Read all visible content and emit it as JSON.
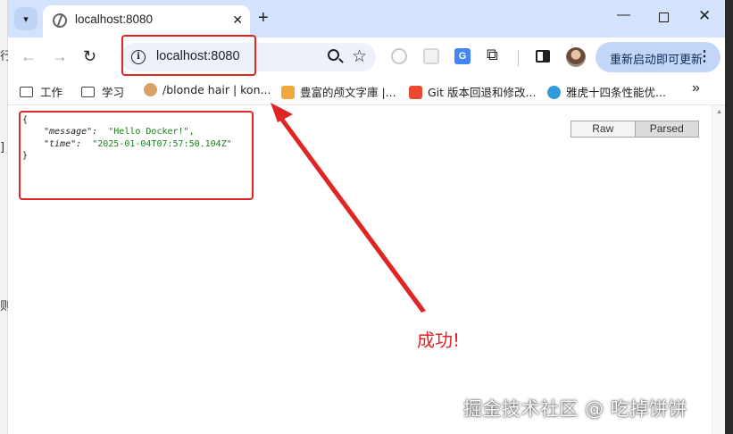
{
  "left_strip": {
    "chars": [
      "行",
      "]",
      "则"
    ]
  },
  "tab": {
    "title": "localhost:8080",
    "close": "✕"
  },
  "window_controls": {
    "new_tab": "+",
    "minimize": "—",
    "close": "✕"
  },
  "toolbar": {
    "back": "←",
    "forward": "→",
    "reload": "↻",
    "url": "localhost:8080",
    "info": "i",
    "star": "☆",
    "translate": "G",
    "extensions": "⧉",
    "update_label": "重新启动即可更新",
    "menu": "⋮"
  },
  "bookmarks": [
    {
      "label": "工作",
      "icon": "folder-icon"
    },
    {
      "label": "学习",
      "icon": "folder-icon"
    },
    {
      "label": "/blonde hair | kon...",
      "icon": "anime-icon",
      "color": "#d9a066"
    },
    {
      "label": "豊富的颅文字庫 |...",
      "icon": "font-library-icon",
      "color": "#f0a83c"
    },
    {
      "label": "Git 版本回退和修改...",
      "icon": "csdn-icon",
      "color": "#e8492f"
    },
    {
      "label": "雅虎十四条性能优...",
      "icon": "cloud-icon",
      "color": "#2f9bd8"
    }
  ],
  "bookmarks_overflow": "»",
  "json_view": {
    "open": "{",
    "line1_key": "\"message\":",
    "line1_value": "\"Hello Docker!\",",
    "line2_key": "\"time\":",
    "line2_value": "\"2025-01-04T07:57:50.104Z\"",
    "close": "}"
  },
  "view_toggle": {
    "raw": "Raw",
    "parsed": "Parsed",
    "active": "Parsed"
  },
  "annotation": {
    "success_text": "成功!",
    "color": "#e02525"
  },
  "watermark": "掘金技术社区 @ 吃掉饼饼",
  "colors": {
    "tabstrip": "#d3e3fd",
    "omnibox": "#edf2fa",
    "update_button": "#c2d7f7",
    "highlight": "#e02525"
  }
}
